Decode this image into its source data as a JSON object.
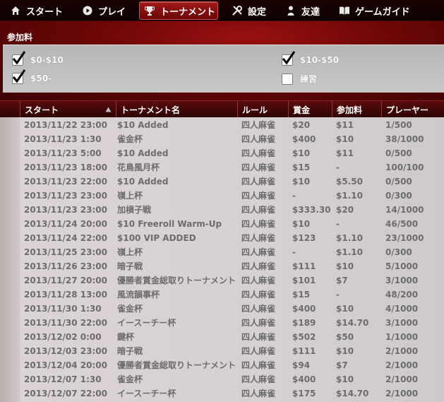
{
  "nav": {
    "items": [
      {
        "label": "スタート",
        "icon": "home-icon"
      },
      {
        "label": "プレイ",
        "icon": "play-icon"
      },
      {
        "label": "トーナメント",
        "icon": "trophy-icon",
        "active": true
      },
      {
        "label": "設定",
        "icon": "tools-icon"
      },
      {
        "label": "友達",
        "icon": "person-icon"
      },
      {
        "label": "ゲームガイド",
        "icon": "book-icon"
      }
    ]
  },
  "filters": {
    "title": "参加料",
    "options": [
      {
        "label": "$0-$10",
        "checked": true
      },
      {
        "label": "$10-$50",
        "checked": true
      },
      {
        "label": "$50-",
        "checked": true
      },
      {
        "label": "練習",
        "checked": false
      }
    ]
  },
  "table": {
    "columns": [
      "スタート",
      "トーナメント名",
      "ルール",
      "賞金",
      "参加料",
      "プレーヤー"
    ],
    "sort_column": "スタート",
    "rows": [
      [
        "2013/11/22 23:00",
        "$10 Added",
        "四人麻雀",
        "$20",
        "$11",
        "1/500"
      ],
      [
        "2013/11/23 1:30",
        "雀金杯",
        "四人麻雀",
        "$400",
        "$10",
        "38/1000"
      ],
      [
        "2013/11/23 5:00",
        "$10 Added",
        "四人麻雀",
        "$10",
        "$11",
        "0/500"
      ],
      [
        "2013/11/23 18:00",
        "花鳥風月杯",
        "四人麻雀",
        "$15",
        "-",
        "100/100"
      ],
      [
        "2013/11/23 22:00",
        "$10 Added",
        "四人麻雀",
        "$10",
        "$5.50",
        "0/500"
      ],
      [
        "2013/11/23 23:00",
        "嶺上杯",
        "四人麻雀",
        "-",
        "$1.10",
        "0/300"
      ],
      [
        "2013/11/23 23:00",
        "加槓子戦",
        "四人麻雀",
        "$333.30",
        "$20",
        "14/1000"
      ],
      [
        "2013/11/24 20:00",
        "$10 Freeroll Warm-Up",
        "四人麻雀",
        "$10",
        "-",
        "46/500"
      ],
      [
        "2013/11/24 22:00",
        "$100 VIP ADDED",
        "四人麻雀",
        "$123",
        "$1.10",
        "23/1000"
      ],
      [
        "2013/11/25 23:00",
        "嶺上杯",
        "四人麻雀",
        "-",
        "$1.10",
        "0/300"
      ],
      [
        "2013/11/26 23:00",
        "暗子戦",
        "四人麻雀",
        "$111",
        "$10",
        "5/1000"
      ],
      [
        "2013/11/27 20:00",
        "優勝者賞金総取りトーナメント",
        "四人麻雀",
        "$101",
        "$7",
        "3/1000"
      ],
      [
        "2013/11/28 13:00",
        "風流韻事杯",
        "四人麻雀",
        "$15",
        "-",
        "48/200"
      ],
      [
        "2013/11/30 1:30",
        "雀金杯",
        "四人麻雀",
        "$400",
        "$10",
        "4/1000"
      ],
      [
        "2013/11/30 22:00",
        "イースーチー杯",
        "四人麻雀",
        "$189",
        "$14.70",
        "3/1000"
      ],
      [
        "2013/12/02 0:00",
        "鍵杯",
        "四人麻雀",
        "$502",
        "$50",
        "1/1000"
      ],
      [
        "2013/12/03 23:00",
        "暗子戦",
        "四人麻雀",
        "$111",
        "$10",
        "2/1000"
      ],
      [
        "2013/12/04 20:00",
        "優勝者賞金総取りトーナメント",
        "四人麻雀",
        "$94",
        "$7",
        "2/1000"
      ],
      [
        "2013/12/07 1:30",
        "雀金杯",
        "四人麻雀",
        "$400",
        "$10",
        "2/1000"
      ],
      [
        "2013/12/07 22:00",
        "イースーチー杯",
        "四人麻雀",
        "$175",
        "$14.70",
        "2/1000"
      ]
    ]
  },
  "colors": {
    "accent": "#8c0d0d",
    "row_text": "#6c6c6c"
  }
}
